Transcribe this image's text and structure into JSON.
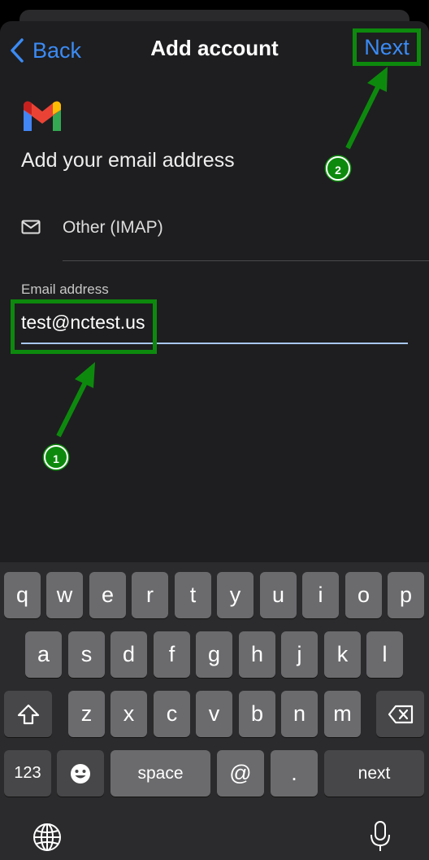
{
  "nav": {
    "back_label": "Back",
    "title": "Add account",
    "next_label": "Next"
  },
  "heading": "Add your email address",
  "provider": {
    "label": "Other (IMAP)",
    "icon": "mail-icon"
  },
  "email_field": {
    "label": "Email address",
    "value": "test@nctest.us"
  },
  "annotations": {
    "step1": "1",
    "step2": "2",
    "color": "#0d8a0d"
  },
  "keyboard": {
    "row1": [
      "q",
      "w",
      "e",
      "r",
      "t",
      "y",
      "u",
      "i",
      "o",
      "p"
    ],
    "row2": [
      "a",
      "s",
      "d",
      "f",
      "g",
      "h",
      "j",
      "k",
      "l"
    ],
    "row3": [
      "z",
      "x",
      "c",
      "v",
      "b",
      "n",
      "m"
    ],
    "numbers_label": "123",
    "space_label": "space",
    "at_label": "@",
    "dot_label": ".",
    "return_label": "next",
    "icons": [
      "shift-icon",
      "backspace-icon",
      "emoji-icon",
      "globe-icon",
      "microphone-icon"
    ]
  },
  "colors": {
    "accent": "#3b8bf5",
    "annotation": "#0d8a0d",
    "field_underline": "#a9c7f5"
  }
}
